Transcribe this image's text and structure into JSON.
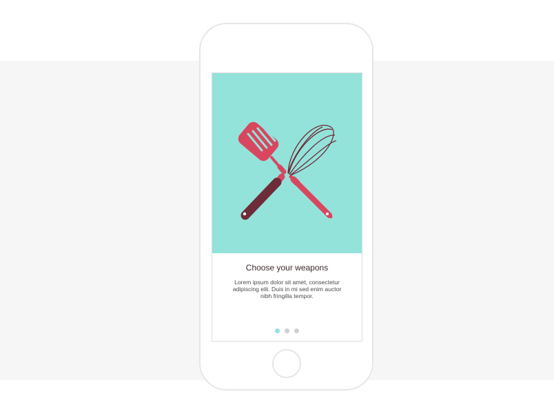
{
  "onboarding": {
    "title": "Choose your weapons",
    "description": "Lorem ipsum dolor sit amet, consectetur adipiscing elit. Duis in mi sed enim auctor nibh fringilla tempor.",
    "pager": {
      "total": 3,
      "active_index": 0
    },
    "illustration": {
      "icons": [
        "spatula-icon",
        "whisk-icon"
      ],
      "background_color": "#93e3da",
      "spatula_head_color": "#d9465f",
      "spatula_handle_color": "#6e2b38",
      "whisk_color": "#d9465f"
    }
  }
}
